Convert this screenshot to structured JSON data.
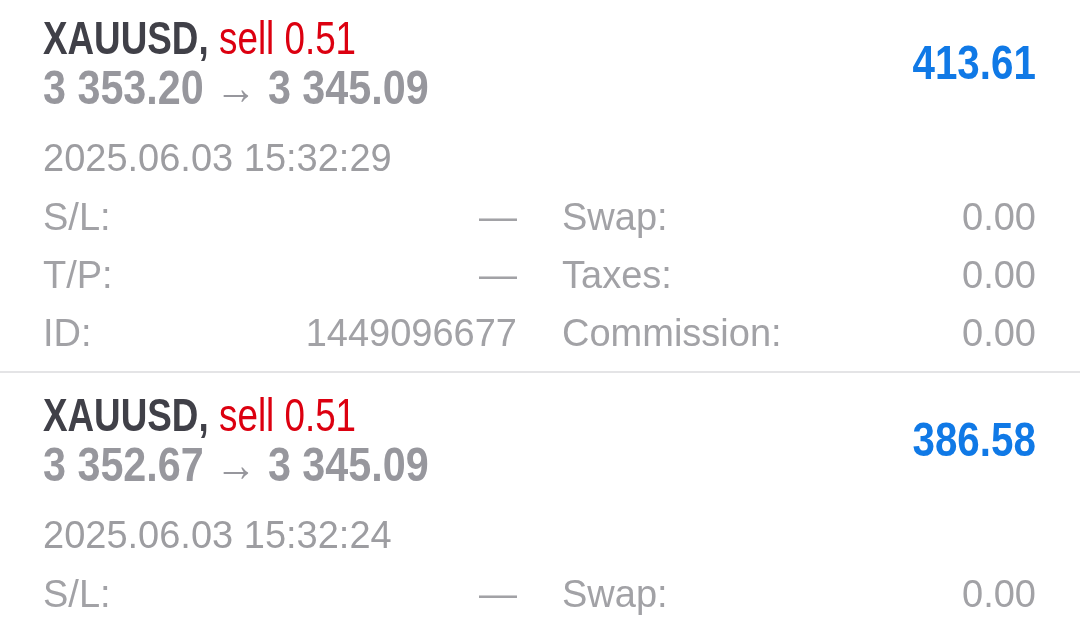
{
  "positions": [
    {
      "symbol": "XAUUSD,",
      "side": "sell 0.51",
      "prices": "3 353.20 → 3 345.09",
      "profit": "413.61",
      "time": "2025.06.03 15:32:29",
      "fields": [
        {
          "label": "S/L:",
          "value": "—"
        },
        {
          "label": "Swap:",
          "value": "0.00"
        },
        {
          "label": "T/P:",
          "value": "—"
        },
        {
          "label": "Taxes:",
          "value": "0.00"
        },
        {
          "label": "ID:",
          "value": "1449096677"
        },
        {
          "label": "Commission:",
          "value": "0.00"
        }
      ]
    },
    {
      "symbol": "XAUUSD,",
      "side": "sell 0.51",
      "prices": "3 352.67 → 3 345.09",
      "profit": "386.58",
      "time": "2025.06.03 15:32:24",
      "fields": [
        {
          "label": "S/L:",
          "value": "—"
        },
        {
          "label": "Swap:",
          "value": "0.00"
        }
      ]
    }
  ]
}
